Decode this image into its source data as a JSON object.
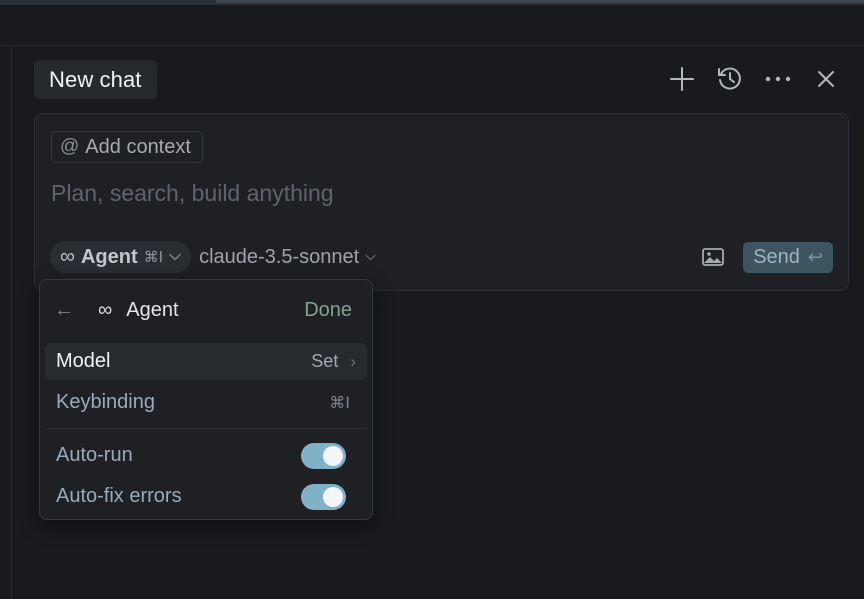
{
  "header": {
    "title": "New chat",
    "actions": [
      "plus-icon",
      "history-icon",
      "more-icon",
      "close-icon"
    ]
  },
  "composer": {
    "add_context_symbol": "@",
    "add_context_label": "Add context",
    "prompt_placeholder": "Plan, search, build anything",
    "mode_label": "Agent",
    "mode_shortcut": "⌘I",
    "model_label": "claude-3.5-sonnet",
    "send_label": "Send",
    "send_hint": "↩"
  },
  "popover": {
    "title": "Agent",
    "done_label": "Done",
    "model_row": {
      "label": "Model",
      "value": "Set"
    },
    "keybinding_row": {
      "label": "Keybinding",
      "shortcut": "⌘I"
    },
    "toggles": [
      {
        "label": "Auto-run",
        "on": true
      },
      {
        "label": "Auto-fix errors",
        "on": true
      }
    ]
  },
  "colors": {
    "background": "#181a1e",
    "send_button": "#3c5561",
    "toggle_on": "#7fb2c6",
    "done_accent": "#7fa593"
  }
}
